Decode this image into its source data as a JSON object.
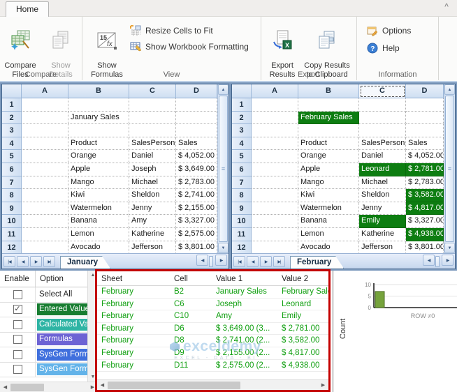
{
  "icons": {
    "scroll_up": "▲",
    "scroll_down": "▼",
    "scroll_left": "◀",
    "scroll_right": "▶",
    "nav_first": "|◀",
    "nav_prev": "◀",
    "nav_next": "▶",
    "nav_last": "▶|",
    "caret": "^",
    "check": "✓",
    "grip": "≡"
  },
  "ribbon": {
    "tab": "Home",
    "groups": [
      {
        "label": "Compare",
        "items": [
          {
            "label": "Compare\nFiles"
          },
          {
            "label": "Show\nDetails"
          }
        ]
      },
      {
        "label": "View",
        "items": [
          {
            "label": "Show\nFormulas"
          },
          {
            "label": "Resize Cells to Fit"
          },
          {
            "label": "Show Workbook Formatting"
          }
        ]
      },
      {
        "label": "Export",
        "items": [
          {
            "label": "Export\nResults"
          },
          {
            "label": "Copy Results\nto Clipboard"
          }
        ]
      },
      {
        "label": "Information",
        "items": [
          {
            "label": "Options"
          },
          {
            "label": "Help"
          }
        ]
      }
    ]
  },
  "sheet_columns": [
    "A",
    "B",
    "C",
    "D"
  ],
  "panes": [
    {
      "sheet_tab": "January",
      "selected_col": null,
      "highlights": [],
      "rows": [
        [
          "",
          "",
          ""
        ],
        [
          "January Sales",
          "",
          ""
        ],
        [
          "",
          "",
          ""
        ],
        [
          "Product",
          "SalesPerson",
          "Sales"
        ],
        [
          "Orange",
          "Daniel",
          "$ 4,052.00"
        ],
        [
          "Apple",
          "Joseph",
          "$ 3,649.00"
        ],
        [
          "Mango",
          "Michael",
          "$ 2,783.00"
        ],
        [
          "Kiwi",
          "Sheldon",
          "$ 2,741.00"
        ],
        [
          "Watermelon",
          "Jenny",
          "$ 2,155.00"
        ],
        [
          "Banana",
          "Amy",
          "$ 3,327.00"
        ],
        [
          "Lemon",
          "Katherine",
          "$ 2,575.00"
        ],
        [
          "Avocado",
          "Jefferson",
          "$ 3,801.00"
        ]
      ]
    },
    {
      "sheet_tab": "February",
      "selected_col": "C",
      "highlights": [
        "B2",
        "C6",
        "D6",
        "D8",
        "D9",
        "C10",
        "D11"
      ],
      "rows": [
        [
          "",
          "",
          ""
        ],
        [
          "February Sales",
          "",
          ""
        ],
        [
          "",
          "",
          ""
        ],
        [
          "Product",
          "SalesPerson",
          "Sales"
        ],
        [
          "Orange",
          "Daniel",
          "$ 4,052.00"
        ],
        [
          "Apple",
          "Leonard",
          "$ 2,781.00"
        ],
        [
          "Mango",
          "Michael",
          "$ 2,783.00"
        ],
        [
          "Kiwi",
          "Sheldon",
          "$ 3,582.00"
        ],
        [
          "Watermelon",
          "Jenny",
          "$ 4,817.00"
        ],
        [
          "Banana",
          "Emily",
          "$ 3,327.00"
        ],
        [
          "Lemon",
          "Katherine",
          "$ 4,938.00"
        ],
        [
          "Avocado",
          "Jefferson",
          "$ 3,801.00"
        ]
      ]
    }
  ],
  "options": {
    "headers": [
      "Enable",
      "Option"
    ],
    "rows": [
      {
        "label": "Select All",
        "checked": false,
        "color": null,
        "text_color": "#222"
      },
      {
        "label": "Entered Values",
        "checked": true,
        "color": "#187d31",
        "text_color": "#fff"
      },
      {
        "label": "Calculated Values",
        "checked": false,
        "color": "#2eb4a4",
        "text_color": "#fff"
      },
      {
        "label": "Formulas",
        "checked": false,
        "color": "#6d63d4",
        "text_color": "#fff"
      },
      {
        "label": "SysGen Formulas",
        "checked": false,
        "color": "#3f6fdd",
        "text_color": "#fff"
      },
      {
        "label": "SysGen Formulas",
        "checked": false,
        "color": "#63b3e9",
        "text_color": "#fff"
      }
    ]
  },
  "results": {
    "headers": [
      "Sheet",
      "Cell",
      "Value 1",
      "Value 2"
    ],
    "rows": [
      [
        "February",
        "B2",
        "January Sales",
        "February Sales"
      ],
      [
        "February",
        "C6",
        "Joseph",
        "Leonard"
      ],
      [
        "February",
        "C10",
        "Amy",
        "Emily"
      ],
      [
        "February",
        "D6",
        "$ 3,649.00  (3...",
        "$ 2,781.00"
      ],
      [
        "February",
        "D8",
        "$ 2,741.00  (2...",
        "$ 3,582.00"
      ],
      [
        "February",
        "D9",
        "$ 2,155.00  (2...",
        "$ 4,817.00"
      ],
      [
        "February",
        "D11",
        "$ 2,575.00  (2...",
        "$ 4,938.00"
      ]
    ]
  },
  "watermark": {
    "brand": "exceldemy",
    "tagline": "EXCEL - DATA - BI"
  },
  "chart_data": {
    "type": "bar",
    "categories": [
      "ROW ≠0"
    ],
    "values": [
      7
    ],
    "title": "",
    "xlabel": "ROW ≠0",
    "ylabel": "Count",
    "yticks": [
      0,
      5,
      10
    ],
    "ylim": [
      0,
      10
    ],
    "bar_color": "#76a33c",
    "bar_border": "#4e6e24"
  }
}
